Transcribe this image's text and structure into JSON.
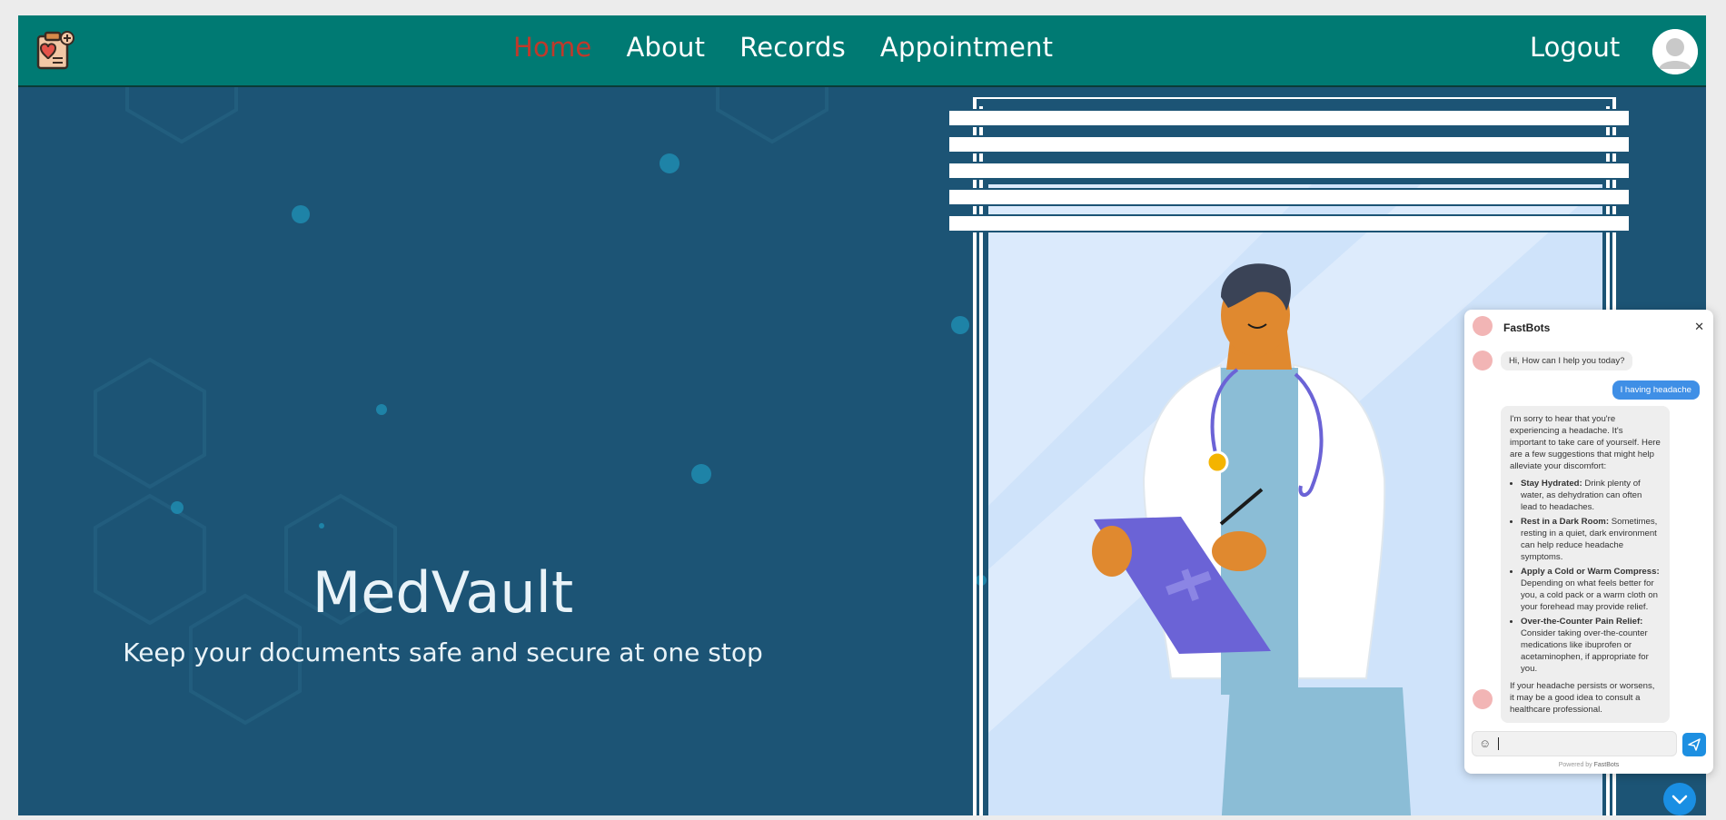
{
  "navbar": {
    "links": [
      {
        "label": "Home",
        "active": true
      },
      {
        "label": "About",
        "active": false
      },
      {
        "label": "Records",
        "active": false
      },
      {
        "label": "Appointment",
        "active": false
      }
    ],
    "logout_label": "Logout",
    "logo_icon": "medical-clipboard-heart-icon",
    "avatar_icon": "user-avatar-icon"
  },
  "hero": {
    "title": "MedVault",
    "subtitle": "Keep your documents safe and secure at one stop",
    "illustration": "doctor-with-clipboard-illustration"
  },
  "chat": {
    "bot_name": "FastBots",
    "greeting": "Hi, How can I help you today?",
    "user_message": "I having headache",
    "reply_intro": "I'm sorry to hear that you're experiencing a headache. It's important to take care of yourself. Here are a few suggestions that might help alleviate your discomfort:",
    "tips": [
      {
        "title": "Stay Hydrated:",
        "text": "Drink plenty of water, as dehydration can often lead to headaches."
      },
      {
        "title": "Rest in a Dark Room:",
        "text": "Sometimes, resting in a quiet, dark environment can help reduce headache symptoms."
      },
      {
        "title": "Apply a Cold or Warm Compress:",
        "text": "Depending on what feels better for you, a cold pack or a warm cloth on your forehead may provide relief."
      },
      {
        "title": "Over-the-Counter Pain Relief:",
        "text": "Consider taking over-the-counter medications like ibuprofen or acetaminophen, if appropriate for you."
      }
    ],
    "reply_outro": "If your headache persists or worsens, it may be a good idea to consult a healthcare professional.",
    "input_value": "",
    "powered_prefix": "Powered by",
    "powered_brand": "FastBots",
    "close_icon": "close-icon",
    "send_icon": "send-icon",
    "emoji_icon": "emoji-icon"
  },
  "scroll_button_icon": "chevron-down-icon",
  "colors": {
    "navbar_bg": "#007a73",
    "hero_bg": "#1c5475",
    "active_link": "#c0392b",
    "user_bubble": "#3f8fe6",
    "send_button": "#1d8fe1"
  }
}
